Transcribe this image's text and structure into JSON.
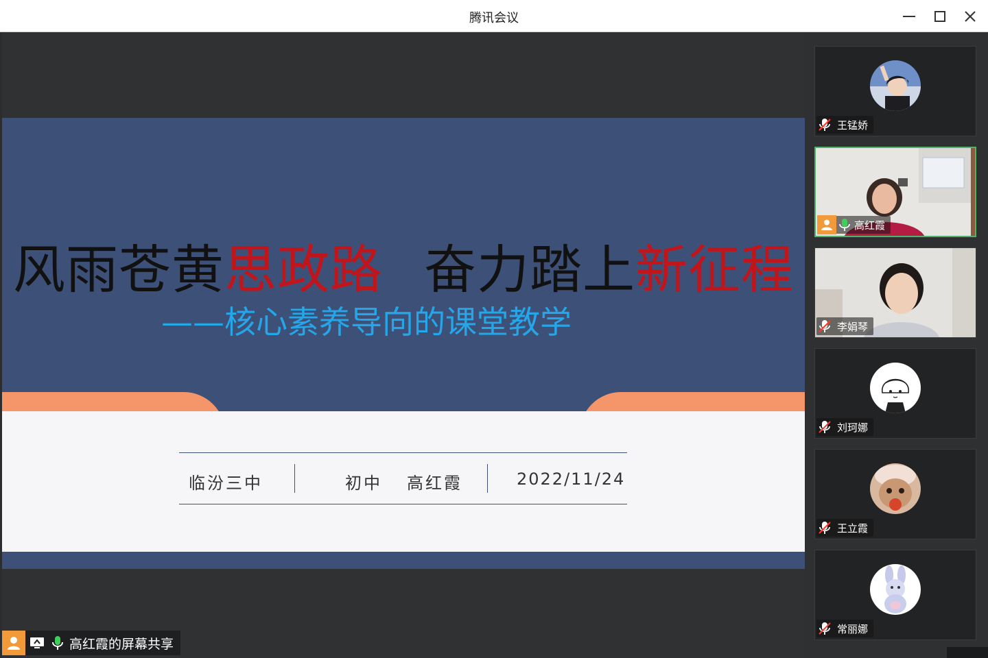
{
  "window": {
    "title": "腾讯会议"
  },
  "slide": {
    "title_black_1": "风雨苍黄",
    "title_red_1": "思政路",
    "title_black_2": "奋力踏上",
    "title_red_2": "新征程",
    "subtitle": "——核心素养导向的课堂教学",
    "school": "临汾三中",
    "grade": "初中",
    "teacher": "高红霞",
    "date": "2022/11/24"
  },
  "sharer": {
    "label": "高红霞的屏幕共享"
  },
  "participants": [
    {
      "name": "王锰娇",
      "mic": "muted",
      "avatar": "photo-avatar"
    },
    {
      "name": "高红霞",
      "mic": "on",
      "host": true,
      "video": "camera-video"
    },
    {
      "name": "李娟琴",
      "mic": "muted",
      "video": "camera-video"
    },
    {
      "name": "刘珂娜",
      "mic": "muted",
      "avatar": "cartoon-girl-avatar"
    },
    {
      "name": "王立霞",
      "mic": "muted",
      "avatar": "cat-avatar"
    },
    {
      "name": "常丽娜",
      "mic": "muted",
      "avatar": "bunny-toy-avatar"
    }
  ],
  "colors": {
    "slide_blue": "#3c5078",
    "accent_orange": "#f4956a",
    "title_red": "#c0161b",
    "subtitle_blue": "#25a6e8",
    "active_speaker_green": "#4fb36a",
    "host_orange": "#f29a3a"
  }
}
